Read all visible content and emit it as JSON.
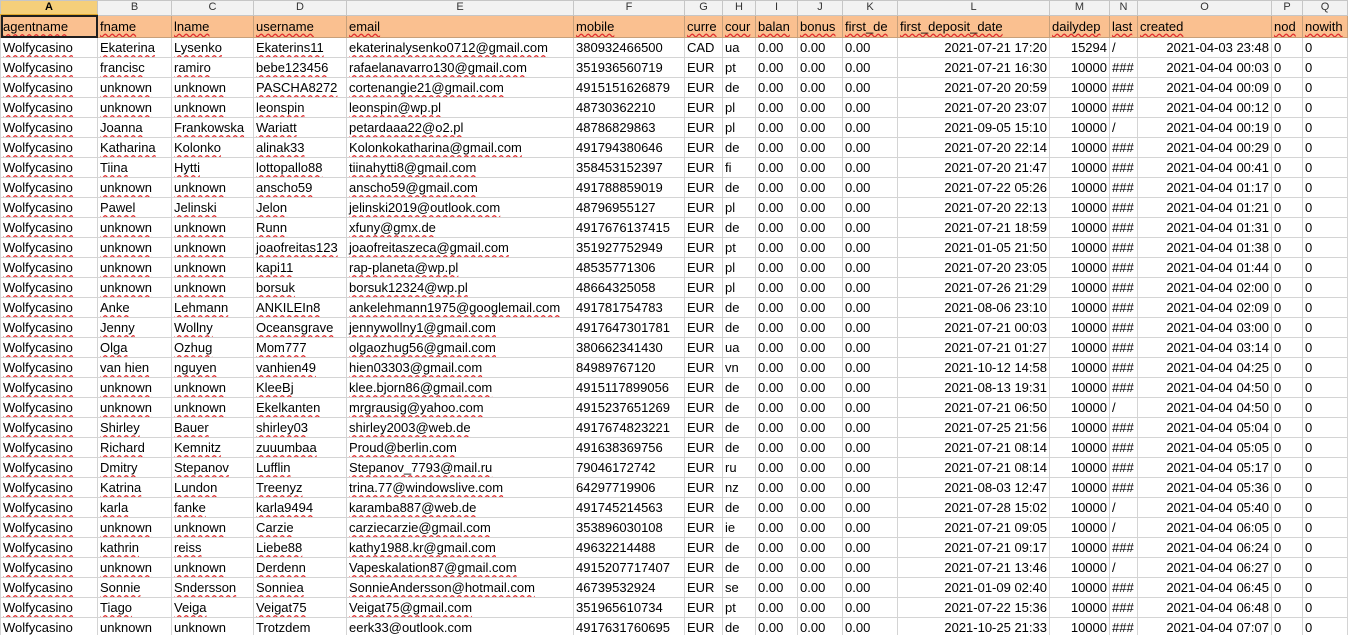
{
  "sheet": {
    "column_letters": [
      "A",
      "B",
      "C",
      "D",
      "E",
      "F",
      "G",
      "H",
      "I",
      "J",
      "K",
      "L",
      "M",
      "N",
      "O",
      "P",
      "Q"
    ],
    "header_cells": [
      "agentname",
      "fname",
      "lname",
      "username",
      "email",
      "mobile",
      "curre",
      "cour",
      "balan",
      "bonus",
      "first_de",
      "first_deposit_date",
      "dailydep",
      "last",
      "created",
      "nod",
      "nowith"
    ],
    "rows": [
      [
        "Wolfycasino",
        "Ekaterina",
        "Lysenko",
        "Ekaterins11",
        "ekaterinalysenko0712@gmail.com",
        "380932466500",
        "CAD",
        "ua",
        "0.00",
        "0.00",
        "0.00",
        "2021-07-21 17:20",
        "15294",
        "/",
        "2021-04-03 23:48",
        "0",
        "0"
      ],
      [
        "Wolfycasino",
        "francisc",
        "ramiro",
        "bebe123456",
        "rafaelanavarro130@gmail.com",
        "351936560719",
        "EUR",
        "pt",
        "0.00",
        "0.00",
        "0.00",
        "2021-07-21 16:30",
        "10000",
        "###",
        "2021-04-04 00:03",
        "0",
        "0"
      ],
      [
        "Wolfycasino",
        "unknown",
        "unknown",
        "PASCHA8272",
        "cortenangie21@gmail.com",
        "4915151626879",
        "EUR",
        "de",
        "0.00",
        "0.00",
        "0.00",
        "2021-07-20 20:59",
        "10000",
        "###",
        "2021-04-04 00:09",
        "0",
        "0"
      ],
      [
        "Wolfycasino",
        "unknown",
        "unknown",
        "leonspin",
        "leonspin@wp.pl",
        "48730362210",
        "EUR",
        "pl",
        "0.00",
        "0.00",
        "0.00",
        "2021-07-20 23:07",
        "10000",
        "###",
        "2021-04-04 00:12",
        "0",
        "0"
      ],
      [
        "Wolfycasino",
        "Joanna",
        "Frankowska",
        "Wariatt",
        "petardaaa22@o2.pl",
        "48786829863",
        "EUR",
        "pl",
        "0.00",
        "0.00",
        "0.00",
        "2021-09-05 15:10",
        "10000",
        "/",
        "2021-04-04 00:19",
        "0",
        "0"
      ],
      [
        "Wolfycasino",
        "Katharina",
        "Kolonko",
        "alinak33",
        "Kolonkokatharina@gmail.com",
        "491794380646",
        "EUR",
        "de",
        "0.00",
        "0.00",
        "0.00",
        "2021-07-20 22:14",
        "10000",
        "###",
        "2021-04-04 00:29",
        "0",
        "0"
      ],
      [
        "Wolfycasino",
        "Tiina",
        "Hytti",
        "lottopallo88",
        "tiinahytti8@gmail.com",
        "358453152397",
        "EUR",
        "fi",
        "0.00",
        "0.00",
        "0.00",
        "2021-07-20 21:47",
        "10000",
        "###",
        "2021-04-04 00:41",
        "0",
        "0"
      ],
      [
        "Wolfycasino",
        "unknown",
        "unknown",
        "anscho59",
        "anscho59@gmail.com",
        "491788859019",
        "EUR",
        "de",
        "0.00",
        "0.00",
        "0.00",
        "2021-07-22 05:26",
        "10000",
        "###",
        "2021-04-04 01:17",
        "0",
        "0"
      ],
      [
        "Wolfycasino",
        "Pawel",
        "Jelinski",
        "Jelon",
        "jelinski2019@outlook.com",
        "48796955127",
        "EUR",
        "pl",
        "0.00",
        "0.00",
        "0.00",
        "2021-07-20 22:13",
        "10000",
        "###",
        "2021-04-04 01:21",
        "0",
        "0"
      ],
      [
        "Wolfycasino",
        "unknown",
        "unknown",
        "Runn",
        "xfuny@gmx.de",
        "4917676137415",
        "EUR",
        "de",
        "0.00",
        "0.00",
        "0.00",
        "2021-07-21 18:59",
        "10000",
        "###",
        "2021-04-04 01:31",
        "0",
        "0"
      ],
      [
        "Wolfycasino",
        "unknown",
        "unknown",
        "joaofreitas123",
        "joaofreitaszeca@gmail.com",
        "351927752949",
        "EUR",
        "pt",
        "0.00",
        "0.00",
        "0.00",
        "2021-01-05 21:50",
        "10000",
        "###",
        "2021-04-04 01:38",
        "0",
        "0"
      ],
      [
        "Wolfycasino",
        "unknown",
        "unknown",
        "kapi11",
        "rap-planeta@wp.pl",
        "48535771306",
        "EUR",
        "pl",
        "0.00",
        "0.00",
        "0.00",
        "2021-07-20 23:05",
        "10000",
        "###",
        "2021-04-04 01:44",
        "0",
        "0"
      ],
      [
        "Wolfycasino",
        "unknown",
        "unknown",
        "borsuk",
        "borsuk12324@wp.pl",
        "48664325058",
        "EUR",
        "pl",
        "0.00",
        "0.00",
        "0.00",
        "2021-07-26 21:29",
        "10000",
        "###",
        "2021-04-04 02:00",
        "0",
        "0"
      ],
      [
        "Wolfycasino",
        "Anke",
        "Lehmann",
        "ANKILEIn8",
        "ankelehmann1975@googlemail.com",
        "491781754783",
        "EUR",
        "de",
        "0.00",
        "0.00",
        "0.00",
        "2021-08-06 23:10",
        "10000",
        "###",
        "2021-04-04 02:09",
        "0",
        "0"
      ],
      [
        "Wolfycasino",
        "Jenny",
        "Wollny",
        "Oceansgrave",
        "jennywollny1@gmail.com",
        "4917647301781",
        "EUR",
        "de",
        "0.00",
        "0.00",
        "0.00",
        "2021-07-21 00:03",
        "10000",
        "###",
        "2021-04-04 03:00",
        "0",
        "0"
      ],
      [
        "Wolfycasino",
        "Olga",
        "Ozhug",
        "Mom777",
        "olgaozhug56@gmail.com",
        "380662341430",
        "EUR",
        "ua",
        "0.00",
        "0.00",
        "0.00",
        "2021-07-21 01:27",
        "10000",
        "###",
        "2021-04-04 03:14",
        "0",
        "0"
      ],
      [
        "Wolfycasino",
        "van hien",
        "nguyen",
        "vanhien49",
        "hien03303@gmail.com",
        "84989767120",
        "EUR",
        "vn",
        "0.00",
        "0.00",
        "0.00",
        "2021-10-12 14:58",
        "10000",
        "###",
        "2021-04-04 04:25",
        "0",
        "0"
      ],
      [
        "Wolfycasino",
        "unknown",
        "unknown",
        "KleeBj",
        "klee.bjorn86@gmail.com",
        "4915117899056",
        "EUR",
        "de",
        "0.00",
        "0.00",
        "0.00",
        "2021-08-13 19:31",
        "10000",
        "###",
        "2021-04-04 04:50",
        "0",
        "0"
      ],
      [
        "Wolfycasino",
        "unknown",
        "unknown",
        "Ekelkanten",
        "mrgrausig@yahoo.com",
        "4915237651269",
        "EUR",
        "de",
        "0.00",
        "0.00",
        "0.00",
        "2021-07-21 06:50",
        "10000",
        "/",
        "2021-04-04 04:50",
        "0",
        "0"
      ],
      [
        "Wolfycasino",
        "Shirley",
        "Bauer",
        "shirley03",
        "shirley2003@web.de",
        "4917674823221",
        "EUR",
        "de",
        "0.00",
        "0.00",
        "0.00",
        "2021-07-25 21:56",
        "10000",
        "###",
        "2021-04-04 05:04",
        "0",
        "0"
      ],
      [
        "Wolfycasino",
        "Richard",
        "Kemnitz",
        "zuuumbaa",
        "Proud@berlin.com",
        "491638369756",
        "EUR",
        "de",
        "0.00",
        "0.00",
        "0.00",
        "2021-07-21 08:14",
        "10000",
        "###",
        "2021-04-04 05:05",
        "0",
        "0"
      ],
      [
        "Wolfycasino",
        "Dmitry",
        "Stepanov",
        "Lufflin",
        "Stepanov_7793@mail.ru",
        "79046172742",
        "EUR",
        "ru",
        "0.00",
        "0.00",
        "0.00",
        "2021-07-21 08:14",
        "10000",
        "###",
        "2021-04-04 05:17",
        "0",
        "0"
      ],
      [
        "Wolfycasino",
        "Katrina",
        "Lundon",
        "Treenyz",
        "trina.77@windowslive.com",
        "64297719906",
        "EUR",
        "nz",
        "0.00",
        "0.00",
        "0.00",
        "2021-08-03 12:47",
        "10000",
        "###",
        "2021-04-04 05:36",
        "0",
        "0"
      ],
      [
        "Wolfycasino",
        "karla",
        "fanke",
        "karla9494",
        "karamba887@web.de",
        "491745214563",
        "EUR",
        "de",
        "0.00",
        "0.00",
        "0.00",
        "2021-07-28 15:02",
        "10000",
        "/",
        "2021-04-04 05:40",
        "0",
        "0"
      ],
      [
        "Wolfycasino",
        "unknown",
        "unknown",
        "Carzie",
        "carziecarzie@gmail.com",
        "353896030108",
        "EUR",
        "ie",
        "0.00",
        "0.00",
        "0.00",
        "2021-07-21 09:05",
        "10000",
        "/",
        "2021-04-04 06:05",
        "0",
        "0"
      ],
      [
        "Wolfycasino",
        "kathrin",
        "reiss",
        "Liebe88",
        "kathy1988.kr@gmail.com",
        "49632214488",
        "EUR",
        "de",
        "0.00",
        "0.00",
        "0.00",
        "2021-07-21 09:17",
        "10000",
        "###",
        "2021-04-04 06:24",
        "0",
        "0"
      ],
      [
        "Wolfycasino",
        "unknown",
        "unknown",
        "Derdenn",
        "Vapeskalation87@gmail.com",
        "4915207717407",
        "EUR",
        "de",
        "0.00",
        "0.00",
        "0.00",
        "2021-07-21 13:46",
        "10000",
        "/",
        "2021-04-04 06:27",
        "0",
        "0"
      ],
      [
        "Wolfycasino",
        "Sonnie",
        "Sndersson",
        "Sonniea",
        "SonnieAndersson@hotmail.com",
        "46739532924",
        "EUR",
        "se",
        "0.00",
        "0.00",
        "0.00",
        "2021-01-09 02:40",
        "10000",
        "###",
        "2021-04-04 06:45",
        "0",
        "0"
      ],
      [
        "Wolfycasino",
        "Tiago",
        "Veiga",
        "Veigat75",
        "Veigat75@gmail.com",
        "351965610734",
        "EUR",
        "pt",
        "0.00",
        "0.00",
        "0.00",
        "2021-07-22 15:36",
        "10000",
        "###",
        "2021-04-04 06:48",
        "0",
        "0"
      ],
      [
        "Wolfycasino",
        "unknown",
        "unknown",
        "Trotzdem",
        "eerk33@outlook.com",
        "4917631760695",
        "EUR",
        "de",
        "0.00",
        "0.00",
        "0.00",
        "2021-10-25 21:33",
        "10000",
        "###",
        "2021-04-04 07:07",
        "0",
        "0"
      ]
    ]
  }
}
